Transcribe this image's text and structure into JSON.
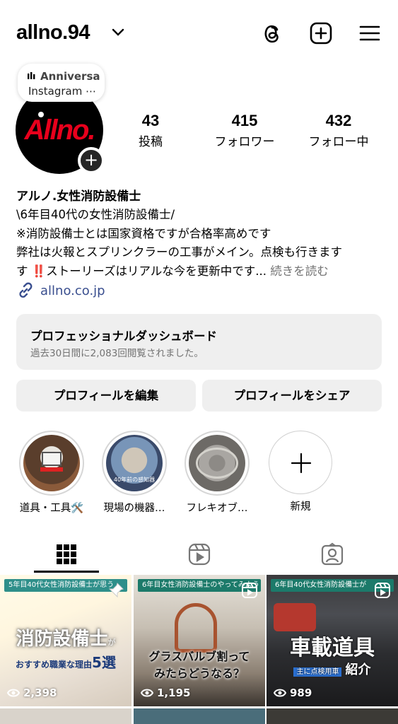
{
  "header": {
    "username": "allno.94"
  },
  "note": {
    "line1": "Anniversa",
    "line2": "Instagram ⋯"
  },
  "avatar": {
    "logo_text": "Allno."
  },
  "stats": [
    {
      "value": "43",
      "label": "投稿"
    },
    {
      "value": "415",
      "label": "フォロワー"
    },
    {
      "value": "432",
      "label": "フォロー中"
    }
  ],
  "bio": {
    "name": "アルノ.女性消防設備士",
    "lines": [
      "\\6年目40代の女性消防設備士/",
      "※消防設備士とは国家資格ですが合格率高めです",
      "弊社は火報とスプリンクラーの工事がメイン。点検も行きます"
    ],
    "last_line_start": "す",
    "emoji": "‼️",
    "last_line_rest": "ストーリーズはリアルな今を更新中です...",
    "more": "続きを読む",
    "link": "allno.co.jp"
  },
  "dashboard": {
    "title": "プロフェッショナルダッシュボード",
    "subtitle": "過去30日間に2,083回閲覧されました。"
  },
  "buttons": {
    "edit": "プロフィールを編集",
    "share": "プロフィールをシェア"
  },
  "highlights": [
    {
      "label": "道具・工具🛠️",
      "inner_text": ""
    },
    {
      "label": "現場の機器…",
      "inner_text": "40年前の感知器"
    },
    {
      "label": "フレキオブ…",
      "inner_text": ""
    },
    {
      "label": "新規",
      "inner_text": ""
    }
  ],
  "tabs": [
    "grid-icon",
    "reels-icon",
    "tagged-icon"
  ],
  "posts": [
    {
      "banner": "5年目40代女性消防設備士が思う",
      "title_big": "消防設備士",
      "title_small": "が",
      "subtitle": "おすすめ職業な理由",
      "subtitle_big": "5選",
      "views": "2,398",
      "pinned": true
    },
    {
      "banner": "6年目女性消防設備士のやってみよう",
      "title_big": "グラスバルブ割って",
      "subtitle": "みたらどうなる？",
      "views": "1,195",
      "reel": true
    },
    {
      "banner": "6年目40代女性消防設備士が",
      "title_big": "車載道具",
      "subtitle": "主に点検用車",
      "subtitle_big": "紹介",
      "views": "989",
      "reel": true
    }
  ],
  "colors": {
    "accent_link": "#3a4f8f",
    "logo_red": "#e8001c",
    "button_bg": "#efefef"
  }
}
